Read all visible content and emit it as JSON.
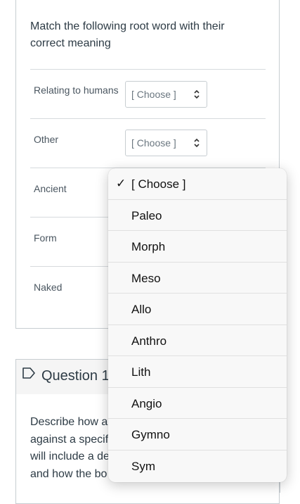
{
  "question1": {
    "prompt_line1": "Match the following root word with their",
    "prompt_line2": "correct meaning",
    "rows": [
      {
        "label": "Relating to humans",
        "select_value": "[ Choose ]"
      },
      {
        "label": "Other",
        "select_value": "[ Choose ]"
      },
      {
        "label": "Ancient"
      },
      {
        "label": "Form"
      },
      {
        "label": "Naked"
      }
    ]
  },
  "dropdown": {
    "selected": "[ Choose ]",
    "check": "✓",
    "options": [
      "[ Choose ]",
      "Paleo",
      "Morph",
      "Meso",
      "Allo",
      "Anthro",
      "Lith",
      "Angio",
      "Gymno",
      "Sym"
    ]
  },
  "question2": {
    "title": "Question 1",
    "lines": [
      "Describe how a",
      "against a specifi",
      "will include a de",
      "and how the bo"
    ]
  }
}
